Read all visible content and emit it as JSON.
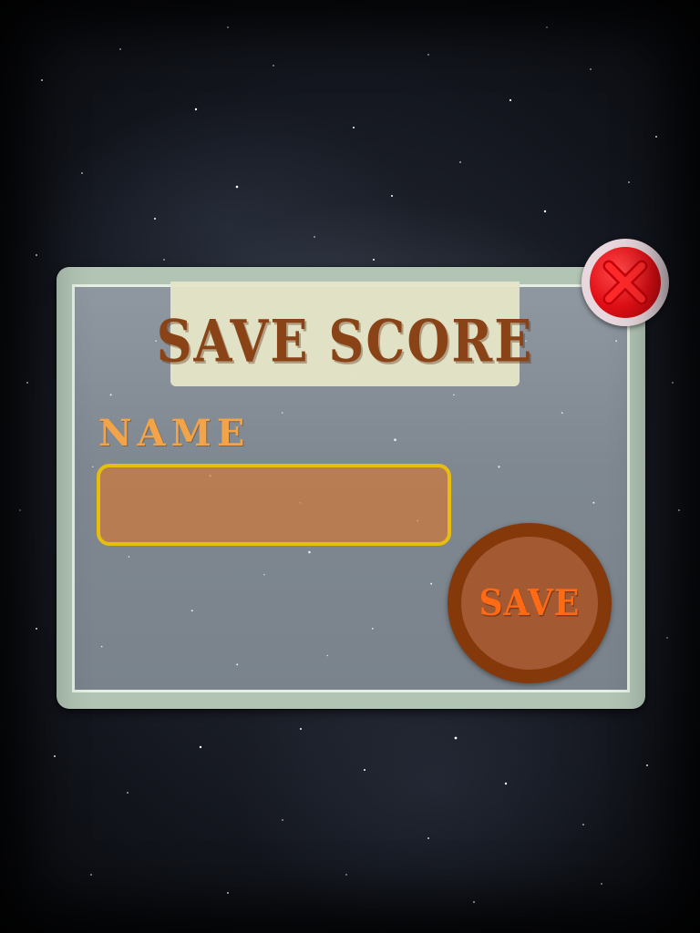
{
  "dialog": {
    "title": "SAVE SCORE",
    "name_label": "NAME",
    "name_input": {
      "value": "",
      "placeholder": ""
    },
    "save_label": "SAVE",
    "close_icon": "close-x-icon"
  },
  "colors": {
    "title_text": "#8a3f10",
    "title_plate": "#e6e6c8",
    "name_label": "#f3a448",
    "input_border": "#e7be0f",
    "input_fill": "#ce783c",
    "save_button": "#85380a",
    "save_label": "#ff6a14",
    "close_button": "#e10f16",
    "panel_frame": "#b2c5b5"
  }
}
